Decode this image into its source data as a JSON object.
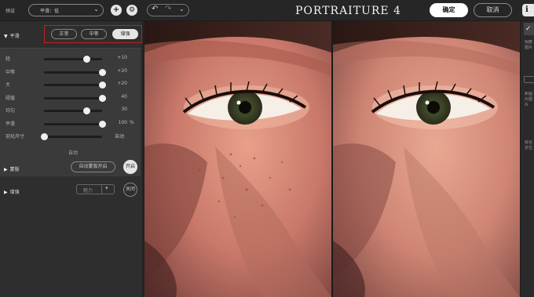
{
  "topbar": {
    "preset_label": "预设",
    "preset_value": "平滑：低",
    "add_icon": "plus-icon",
    "settings_icon": "gear-icon",
    "undo_icon": "undo-icon",
    "redo_icon": "redo-icon",
    "history_icon": "chevron-down-icon",
    "app_title": "PORTRAITURE 4",
    "ok_label": "确定",
    "cancel_label": "取消",
    "info_label": "i"
  },
  "smoothing": {
    "section_label": "平滑",
    "modes": [
      "正常",
      "中等",
      "增强"
    ],
    "active_mode": "增强",
    "sliders": [
      {
        "label": "轻",
        "value": "+10",
        "level": 0.73
      },
      {
        "label": "中等",
        "value": "+20",
        "level": 1.0
      },
      {
        "label": "大",
        "value": "+20",
        "level": 1.0
      },
      {
        "label": "阈值",
        "value": "40",
        "level": 1.0
      },
      {
        "label": "均匀",
        "value": "30",
        "level": 0.73
      },
      {
        "label": "平滑",
        "value": "100",
        "unit": "%",
        "level": 1.0
      },
      {
        "label": "羽化尺寸",
        "value": "自动",
        "level": 0.0
      }
    ],
    "auto_label": "自动"
  },
  "masking": {
    "section_label": "蒙版",
    "auto_mask_label": "自动蒙版开启",
    "toggle_label": "开启"
  },
  "enhance": {
    "section_label": "增强",
    "dropdown_value": "魅力",
    "toggle_label": "关闭"
  },
  "rightstrip": {
    "check_icon": "check-icon",
    "text1": "相册图片",
    "text2": "新图片图片",
    "text3": "综合定位"
  }
}
